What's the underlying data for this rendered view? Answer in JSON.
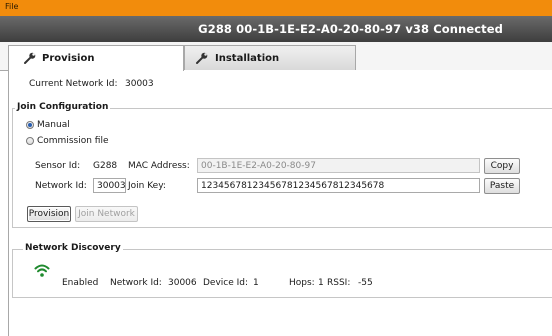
{
  "menu": {
    "file_label": "File"
  },
  "status": {
    "text": "G288  00-1B-1E-E2-A0-20-80-97  v38  Connected"
  },
  "tabs": [
    {
      "label": "Provision",
      "icon": "wrench-icon",
      "active": true
    },
    {
      "label": "Installation",
      "icon": "wrench-icon",
      "active": false
    }
  ],
  "provision": {
    "current_network_label": "Current Network Id:",
    "current_network_value": "30003",
    "join_config": {
      "title": "Join Configuration",
      "manual_label": "Manual",
      "commission_label": "Commission file",
      "sensor_id_label": "Sensor Id:",
      "sensor_id_value": "G288",
      "mac_label": "MAC Address:",
      "mac_value": "00-1B-1E-E2-A0-20-80-97",
      "copy_label": "Copy",
      "network_id_label": "Network Id:",
      "network_id_value": "30003",
      "join_key_label": "Join Key:",
      "join_key_value": "12345678123456781234567812345678",
      "paste_label": "Paste",
      "provision_label": "Provision",
      "join_network_label": "Join Network"
    },
    "discovery": {
      "title": "Network Discovery",
      "icon": "wifi-icon",
      "icon_color": "#1f8a2e",
      "enabled_label": "Enabled",
      "network_id_label": "Network Id:",
      "network_id_value": "30006",
      "device_id_label": "Device Id:",
      "device_id_value": "1",
      "hops_label": "Hops:",
      "hops_value": "1",
      "rssi_label": "RSSI:",
      "rssi_value": "-55"
    }
  },
  "colors": {
    "menubar": "#f28c0c",
    "statusbar": "#4a4a4a",
    "accent": "#2a5fb0"
  }
}
